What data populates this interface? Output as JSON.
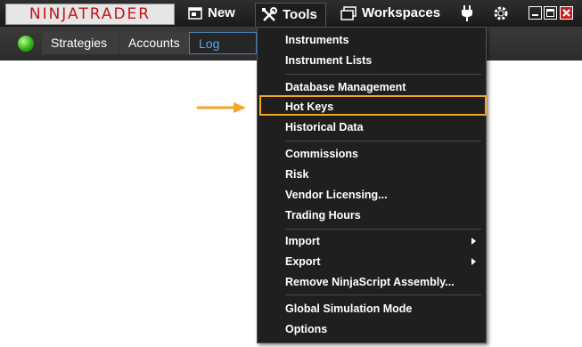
{
  "titlebar": {
    "logo": "NINJATRADER",
    "new_label": "New",
    "tools_label": "Tools",
    "workspaces_label": "Workspaces",
    "icons": [
      "new-window-icon",
      "tools-icon",
      "workspaces-icon",
      "connection-plug-icon",
      "settings-gear-icon",
      "minimize-icon",
      "maximize-icon",
      "close-icon"
    ]
  },
  "toolbar": {
    "tabs": [
      {
        "label": "Strategies"
      },
      {
        "label": "Accounts"
      },
      {
        "label": "Log"
      }
    ],
    "status_color": "#2fb21a"
  },
  "tools_menu": {
    "items": [
      {
        "label": "Instruments"
      },
      {
        "label": "Instrument Lists"
      },
      {
        "label": "Database Management"
      },
      {
        "label": "Hot Keys"
      },
      {
        "label": "Historical Data"
      },
      {
        "label": "Commissions"
      },
      {
        "label": "Risk"
      },
      {
        "label": "Vendor Licensing..."
      },
      {
        "label": "Trading Hours"
      },
      {
        "label": "Import"
      },
      {
        "label": "Export"
      },
      {
        "label": "Remove NinjaScript Assembly..."
      },
      {
        "label": "Global Simulation Mode"
      },
      {
        "label": "Options"
      }
    ],
    "highlight_color": "#f5a623"
  }
}
